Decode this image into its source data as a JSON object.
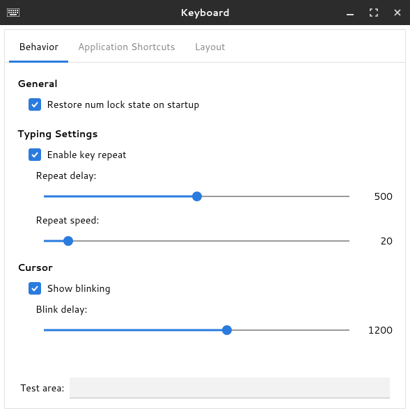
{
  "window": {
    "title": "Keyboard"
  },
  "tabs": {
    "behavior": "Behavior",
    "shortcuts": "Application Shortcuts",
    "layout": "Layout"
  },
  "sections": {
    "general": {
      "title": "General",
      "restore_numlock": "Restore num lock state on startup"
    },
    "typing": {
      "title": "Typing Settings",
      "enable_repeat": "Enable key repeat",
      "repeat_delay_label": "Repeat delay:",
      "repeat_delay_value": "500",
      "repeat_delay_pct": 50,
      "repeat_speed_label": "Repeat speed:",
      "repeat_speed_value": "20",
      "repeat_speed_pct": 8
    },
    "cursor": {
      "title": "Cursor",
      "show_blinking": "Show blinking",
      "blink_delay_label": "Blink delay:",
      "blink_delay_value": "1200",
      "blink_delay_pct": 60
    }
  },
  "test": {
    "label": "Test area:",
    "value": ""
  },
  "colors": {
    "accent": "#2a7bde"
  }
}
